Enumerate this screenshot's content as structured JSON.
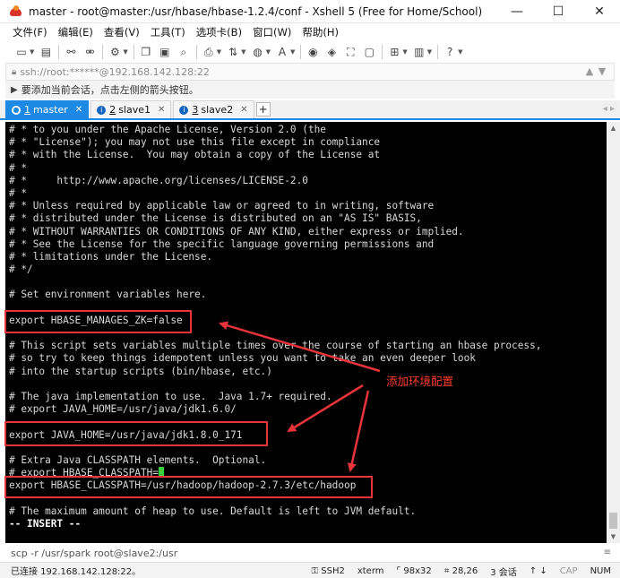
{
  "window": {
    "title": "master - root@master:/usr/hbase/hbase-1.2.4/conf - Xshell 5 (Free for Home/School)",
    "minimize": "—",
    "maximize": "☐",
    "close": "✕"
  },
  "menu": [
    "文件(F)",
    "编辑(E)",
    "查看(V)",
    "工具(T)",
    "选项卡(B)",
    "窗口(W)",
    "帮助(H)"
  ],
  "address": {
    "text": "ssh://root:******@192.168.142.128:22"
  },
  "hint": {
    "text": "要添加当前会话，点击左侧的箭头按钮。"
  },
  "tabs": [
    {
      "num": "1",
      "label": "master",
      "close": "✕"
    },
    {
      "num": "2",
      "label": "slave1",
      "close": "✕"
    },
    {
      "num": "3",
      "label": "slave2",
      "close": "✕"
    }
  ],
  "tab_add": "+",
  "terminal": {
    "lines": [
      "# * to you under the Apache License, Version 2.0 (the",
      "# * \"License\"); you may not use this file except in compliance",
      "# * with the License.  You may obtain a copy of the License at",
      "# *",
      "# *     http://www.apache.org/licenses/LICENSE-2.0",
      "# *",
      "# * Unless required by applicable law or agreed to in writing, software",
      "# * distributed under the License is distributed on an \"AS IS\" BASIS,",
      "# * WITHOUT WARRANTIES OR CONDITIONS OF ANY KIND, either express or implied.",
      "# * See the License for the specific language governing permissions and",
      "# * limitations under the License.",
      "# */",
      "",
      "# Set environment variables here.",
      "",
      "export HBASE_MANAGES_ZK=false",
      "",
      "# This script sets variables multiple times over the course of starting an hbase process,",
      "# so try to keep things idempotent unless you want to take an even deeper look",
      "# into the startup scripts (bin/hbase, etc.)",
      "",
      "# The java implementation to use.  Java 1.7+ required.",
      "# export JAVA_HOME=/usr/java/jdk1.6.0/",
      "",
      "export JAVA_HOME=/usr/java/jdk1.8.0_171",
      "",
      "# Extra Java CLASSPATH elements.  Optional.",
      "# export HBASE_CLASSPATH=",
      "export HBASE_CLASSPATH=/usr/hadoop/hadoop-2.7.3/etc/hadoop",
      "",
      "# The maximum amount of heap to use. Default is left to JVM default.",
      "-- INSERT --"
    ]
  },
  "annotation": {
    "label": "添加环境配置"
  },
  "cmdbar": {
    "text": "scp -r /usr/spark root@slave2:/usr"
  },
  "status": {
    "connection": "已连接 192.168.142.128:22。",
    "protocol": "SSH2",
    "terminal_type": "xterm",
    "size": "98x32",
    "position": "28,26",
    "sessions": "3 会话",
    "caps": "CAP",
    "num": "NUM"
  },
  "colors": {
    "accent": "#1e88e5",
    "annotation": "#e8343a",
    "terminal_bg": "#000000",
    "cursor": "#3cd13c"
  }
}
